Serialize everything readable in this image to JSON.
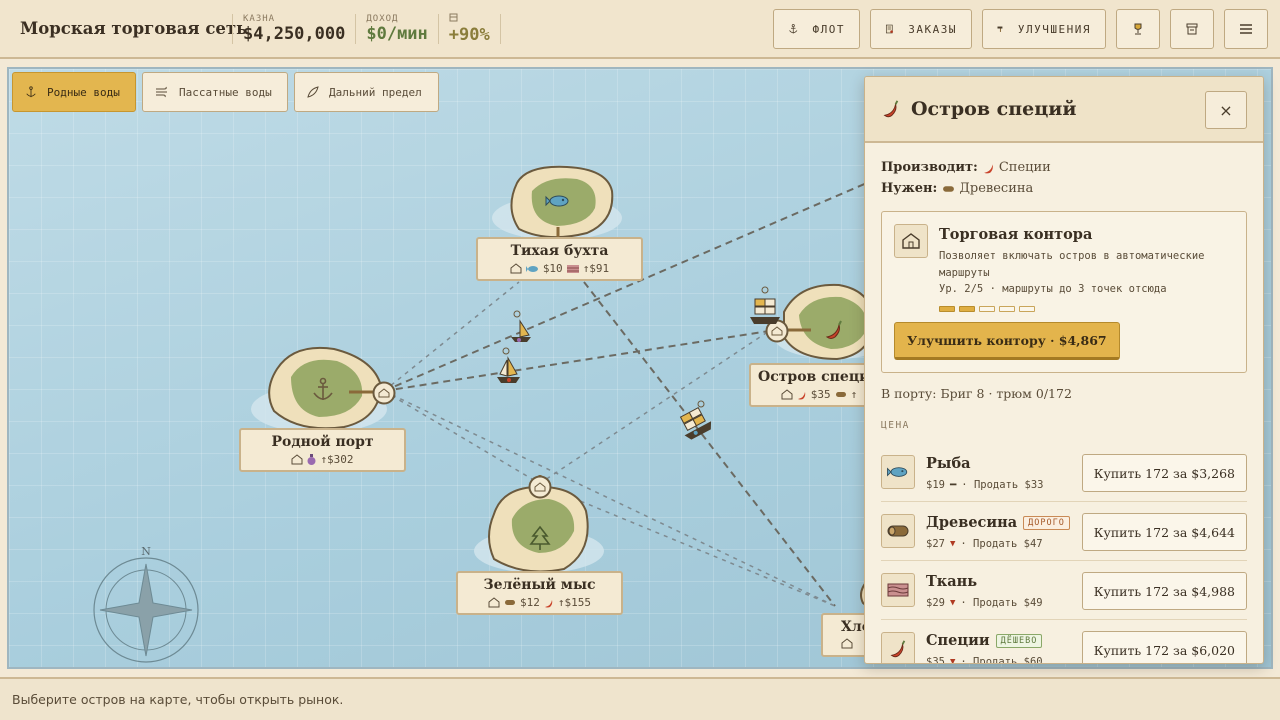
{
  "app": {
    "title": "Морская торговая сеть"
  },
  "stats": {
    "treasury": {
      "label": "КАЗНА",
      "value": "$4,250,000"
    },
    "income": {
      "label": "ДОХОД",
      "value": "$0/мин"
    },
    "bonus": {
      "value": "+90%"
    }
  },
  "toolbar": {
    "fleet": "ФЛОТ",
    "orders": "ЗАКАЗЫ",
    "upgrades": "УЛУЧШЕНИЯ"
  },
  "regions": [
    {
      "label": "Родные воды",
      "active": true
    },
    {
      "label": "Пассатные воды",
      "active": false
    },
    {
      "label": "Дальний предел",
      "active": false
    }
  ],
  "islands": [
    {
      "name": "Тихая бухта",
      "price": "$10",
      "demand": "↑$91"
    },
    {
      "name": "Родной порт",
      "demand": "↑$302"
    },
    {
      "name": "Остров специй",
      "price": "$35",
      "demand": "↑"
    },
    {
      "name": "Зелёный мыс",
      "price": "$12",
      "demand": "↑$155"
    },
    {
      "name": "Хло"
    }
  ],
  "compass": {
    "north": "N"
  },
  "panel": {
    "title": "Остров специй",
    "close": "×",
    "produces_label": "Производит:",
    "produces_value": "Специи",
    "needs_label": "Нужен:",
    "needs_value": "Древесина",
    "office": {
      "title": "Торговая контора",
      "description": "Позволяет включать остров в автоматические маршруты",
      "level": "Ур. 2/5 · маршруты до 3 точек отсюда",
      "level_current": 2,
      "level_max": 5,
      "upgrade_button": "Улучшить контору · $4,867"
    },
    "in_port": "В порту: Бриг 8 · трюм 0/172",
    "price_header": "ЦЕНА",
    "goods": [
      {
        "name": "Рыба",
        "badge": "",
        "price": "$19",
        "trend": "flat",
        "sell": "Продать $33",
        "buy": "Купить 172 за $3,268"
      },
      {
        "name": "Древесина",
        "badge": "ДОРОГО",
        "price": "$27",
        "trend": "down",
        "sell": "Продать $47",
        "buy": "Купить 172 за $4,644"
      },
      {
        "name": "Ткань",
        "badge": "",
        "price": "$29",
        "trend": "down",
        "sell": "Продать $49",
        "buy": "Купить 172 за $4,988"
      },
      {
        "name": "Специи",
        "badge": "ДЁШЕВО",
        "price": "$35",
        "trend": "down",
        "sell": "Продать $60",
        "buy": "Купить 172 за $6,020"
      }
    ]
  },
  "status": {
    "hint": "Выберите остров на карте, чтобы открыть рынок."
  },
  "colors": {
    "accent": "#e3b64f",
    "route": "#6b6a62",
    "sea": "#b3d4e1",
    "land": "#efe0bb",
    "grass": "#9bab6a"
  }
}
